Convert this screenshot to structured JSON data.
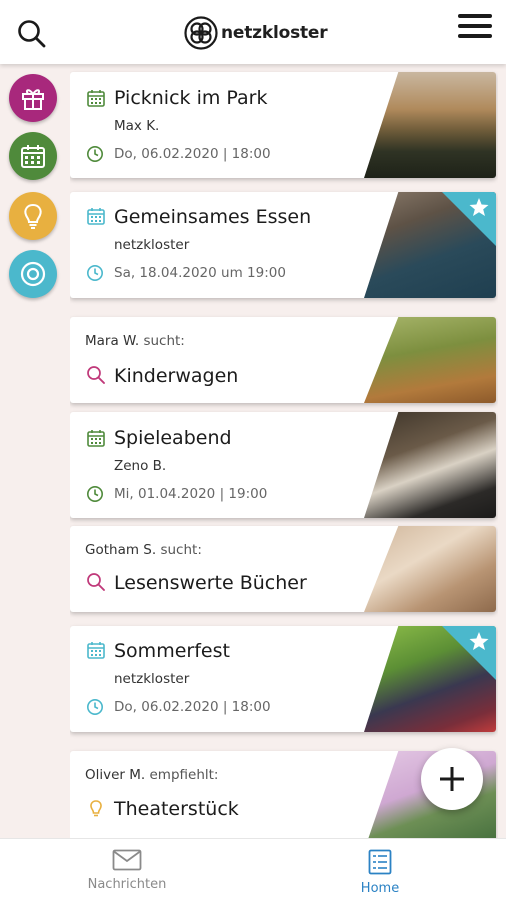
{
  "header": {
    "brand": "netzkloster"
  },
  "colors": {
    "accent": "#2b82c4",
    "event_green": "#4f8a3b",
    "event_teal": "#4bb8cc",
    "search_pink": "#c0397a",
    "idea_yellow": "#e8b040",
    "gift_purple": "#a8287c"
  },
  "categories": [
    {
      "icon": "gift-icon",
      "color": "#a8287c"
    },
    {
      "icon": "calendar-icon",
      "color": "#4f8a3b"
    },
    {
      "icon": "lightbulb-icon",
      "color": "#e8b040"
    },
    {
      "icon": "target-icon",
      "color": "#4bb8cc"
    }
  ],
  "feed": [
    {
      "type": "event",
      "title": "Picknick im Park",
      "author": "Max K.",
      "datetime": "Do, 06.02.2020 | 18:00"
    },
    {
      "type": "event",
      "title": "Gemeinsames Essen",
      "author": "netzkloster",
      "datetime": "Sa, 18.04.2020 um 19:00",
      "featured": true
    },
    {
      "type": "search",
      "author": "Mara W.",
      "verb": "sucht:",
      "title": "Kinderwagen"
    },
    {
      "type": "event",
      "title": "Spieleabend",
      "author": "Zeno B.",
      "datetime": "Mi, 01.04.2020 | 19:00"
    },
    {
      "type": "search",
      "author": "Gotham S.",
      "verb": "sucht:",
      "title": "Lesenswerte Bücher"
    },
    {
      "type": "event",
      "title": "Sommerfest",
      "author": "netzkloster",
      "datetime": "Do, 06.02.2020 | 18:00",
      "featured": true
    },
    {
      "type": "recommendation",
      "author": "Oliver M.",
      "verb": "empfiehlt:",
      "title": "Theaterstück"
    }
  ],
  "bottom_nav": {
    "messages_label": "Nachrichten",
    "home_label": "Home",
    "active": "home"
  }
}
